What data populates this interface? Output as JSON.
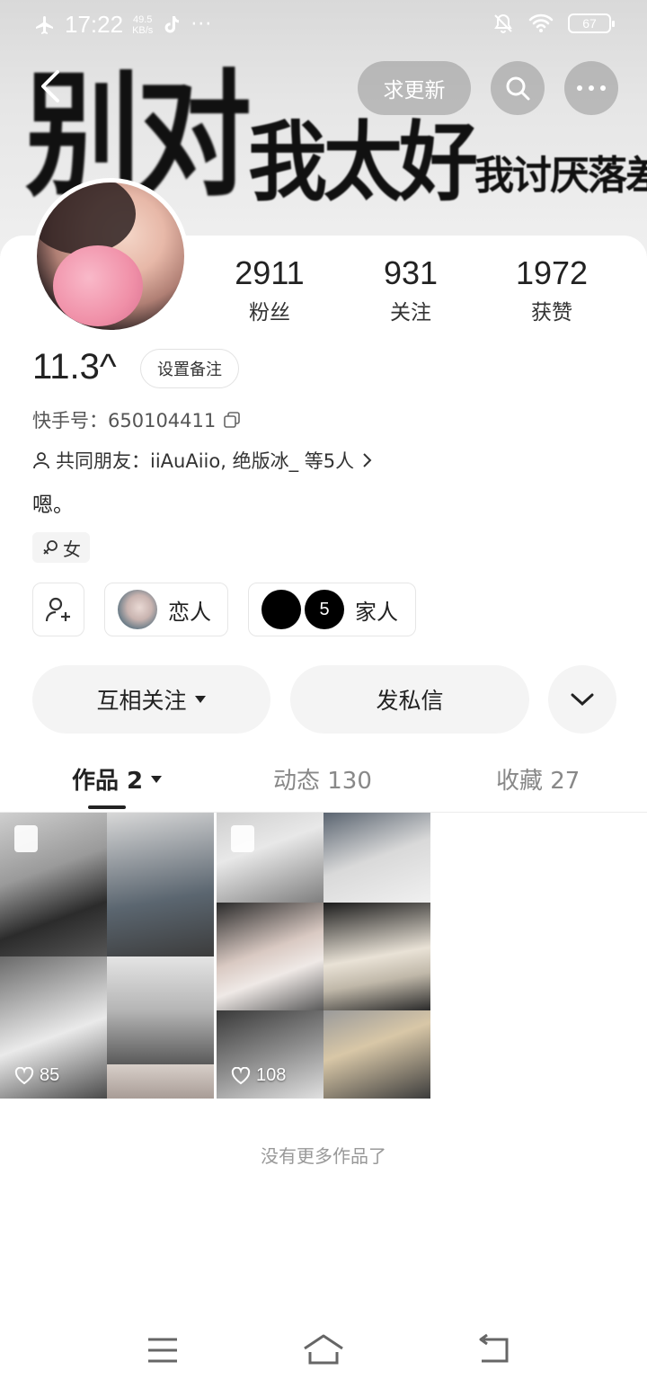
{
  "status_bar": {
    "time": "17:22",
    "speed_value": "49.5",
    "speed_unit": "KB/s",
    "more": "···",
    "battery": "67"
  },
  "banner": {
    "big_text": "别对",
    "mid_text": "我太好",
    "small_text": "我讨厌落差感."
  },
  "top_actions": {
    "request_update_label": "求更新"
  },
  "stats": [
    {
      "value": "2911",
      "label": "粉丝"
    },
    {
      "value": "931",
      "label": "关注"
    },
    {
      "value": "1972",
      "label": "获赞"
    }
  ],
  "profile": {
    "name": "11.3^",
    "set_remark_label": "设置备注",
    "kuaishou_id_label": "快手号：",
    "kuaishou_id": "650104411",
    "mutual_friends": "共同朋友：iiAuAiio, 绝版冰_ 等5人",
    "bio": "嗯。",
    "gender": "女"
  },
  "relations": {
    "lover_label": "恋人",
    "family_count": "5",
    "family_label": "家人"
  },
  "actions": {
    "follow_label": "互相关注",
    "message_label": "发私信"
  },
  "tabs": [
    {
      "label": "作品 2"
    },
    {
      "label": "动态 130"
    },
    {
      "label": "收藏 27"
    }
  ],
  "posts": [
    {
      "likes": "85"
    },
    {
      "likes": "108"
    }
  ],
  "footer": {
    "no_more_label": "没有更多作品了"
  }
}
